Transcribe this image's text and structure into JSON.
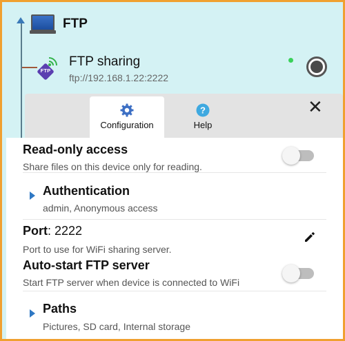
{
  "tree": {
    "root_label": "FTP",
    "share": {
      "title": "FTP sharing",
      "url": "ftp://192.168.1.22:2222",
      "badge": "FTP",
      "status_color": "#3ad15a"
    }
  },
  "dialog": {
    "tabs": [
      {
        "label": "Configuration",
        "icon": "gear-icon",
        "selected": true
      },
      {
        "label": "Help",
        "icon": "help-icon",
        "selected": false
      }
    ],
    "settings": {
      "read_only": {
        "title": "Read-only access",
        "subtitle": "Share files on this device only for reading.",
        "enabled": false
      },
      "authentication": {
        "title": "Authentication",
        "subtitle": "admin, Anonymous access"
      },
      "port": {
        "label": "Port",
        "separator": ": ",
        "value": "2222",
        "subtitle": "Port to use for WiFi sharing server."
      },
      "auto_start": {
        "title": "Auto-start FTP server",
        "subtitle": "Start FTP server when device is connected to WiFi",
        "enabled": false
      },
      "paths": {
        "title": "Paths",
        "subtitle": "Pictures, SD card, Internal storage"
      }
    }
  },
  "colors": {
    "frame_border": "#f0a030",
    "background": "#d4f2f4",
    "accent": "#2f78c4"
  }
}
